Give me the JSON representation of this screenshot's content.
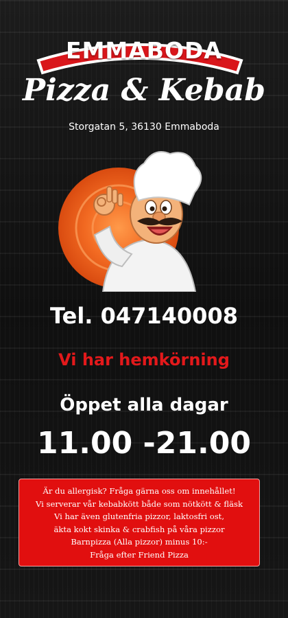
{
  "header": {
    "banner_text": "EMMABODA",
    "title": "Pizza & Kebab",
    "address": "Storgatan 5, 36130 Emmaboda"
  },
  "illustration": {
    "icon": "chef-mascot-icon",
    "bg_color": "#f26a22"
  },
  "contact": {
    "phone": "Tel. 047140008"
  },
  "delivery": {
    "text": "Vi har hemkörning",
    "color": "#e3191b"
  },
  "hours": {
    "label": "Öppet alla dagar",
    "time": "11.00 -21.00"
  },
  "info_box": {
    "bg_color": "#e10f0f",
    "lines": [
      "Är du allergisk?  Fråga gärna oss om innehållet!",
      "Vi serverar vår kebabkött både som nötkött & fläsk",
      "Vi har även glutenfria pizzor, laktosfri ost,",
      "äkta kokt skinka & crabfish på våra pizzor",
      "Barnpizza (Alla pizzor) minus 10:-",
      "Fråga efter Friend Pizza"
    ]
  }
}
